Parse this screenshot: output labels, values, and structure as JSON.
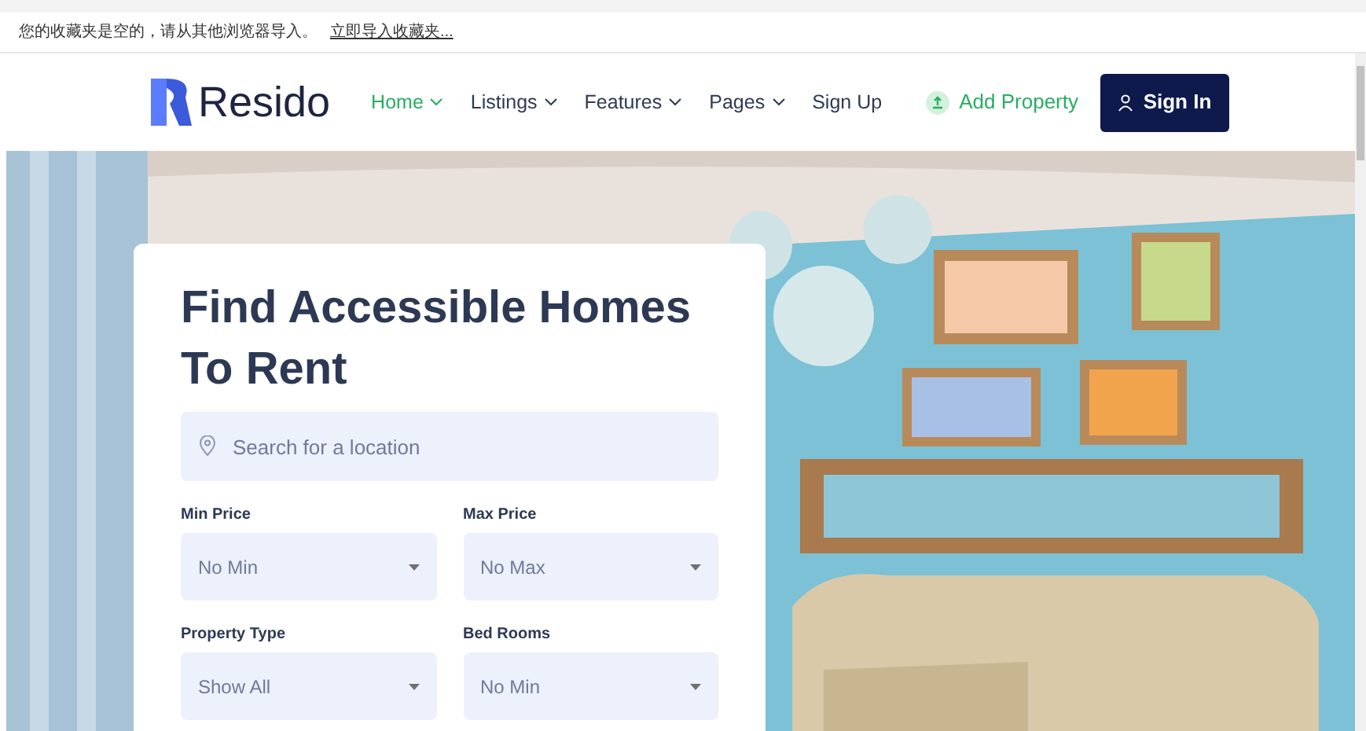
{
  "browser": {
    "bookmarks_message": "您的收藏夹是空的，请从其他浏览器导入。",
    "import_link": "立即导入收藏夹..."
  },
  "nav": {
    "brand": "Resido",
    "items": [
      {
        "label": "Home",
        "selected": true,
        "dropdown": true
      },
      {
        "label": "Listings",
        "selected": false,
        "dropdown": true
      },
      {
        "label": "Features",
        "selected": false,
        "dropdown": true
      },
      {
        "label": "Pages",
        "selected": false,
        "dropdown": true
      },
      {
        "label": "Sign Up",
        "selected": false,
        "dropdown": false
      }
    ],
    "add_property": "Add Property",
    "sign_in": "Sign In"
  },
  "hero": {
    "title": "Find Accessible Homes To Rent",
    "search": {
      "placeholder": "Search for a location"
    },
    "filters": [
      {
        "label": "Min Price",
        "value": "No Min"
      },
      {
        "label": "Max Price",
        "value": "No Max"
      },
      {
        "label": "Property Type",
        "value": "Show All"
      },
      {
        "label": "Bed Rooms",
        "value": "No Min"
      }
    ]
  }
}
